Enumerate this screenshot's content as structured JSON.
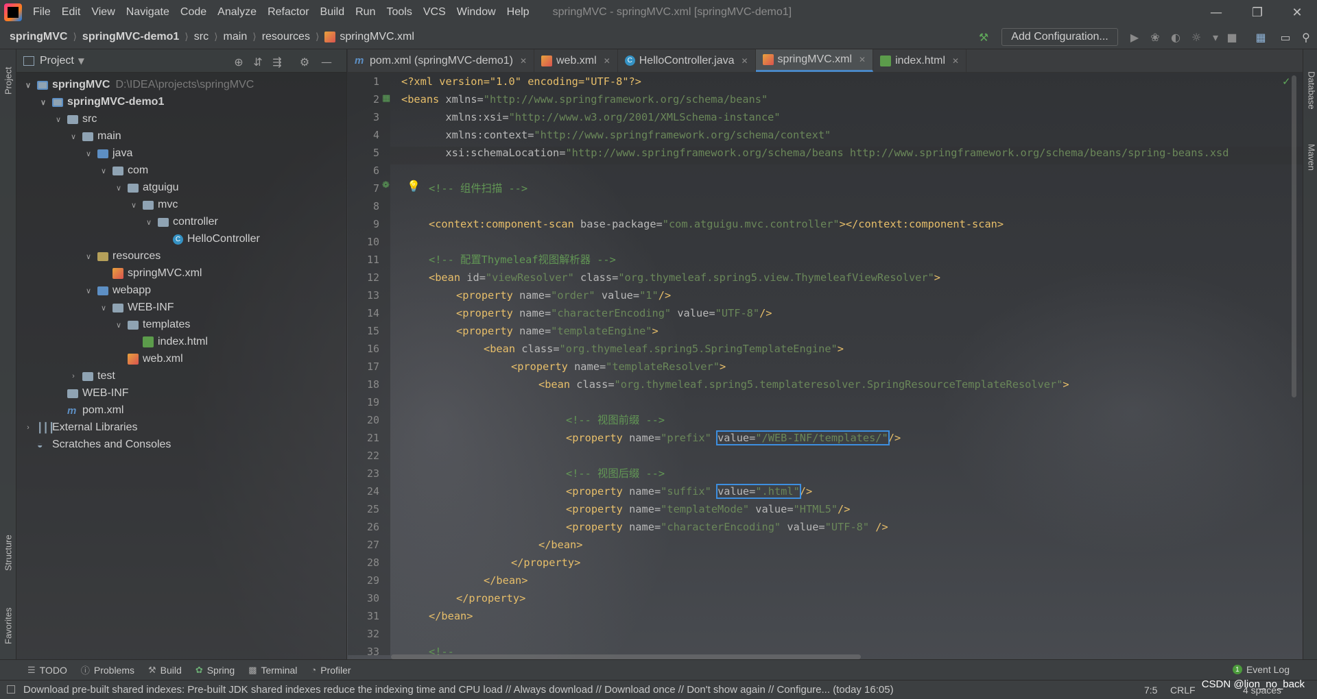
{
  "window": {
    "title": "springMVC - springMVC.xml [springMVC-demo1]",
    "menu": [
      "File",
      "Edit",
      "View",
      "Navigate",
      "Code",
      "Analyze",
      "Refactor",
      "Build",
      "Run",
      "Tools",
      "VCS",
      "Window",
      "Help"
    ]
  },
  "navbar": {
    "breadcrumbs": [
      "springMVC",
      "springMVC-demo1",
      "src",
      "main",
      "resources",
      "springMVC.xml"
    ],
    "add_config": "Add Configuration..."
  },
  "left_strip": {
    "project": "Project",
    "structure": "Structure",
    "favorites": "Favorites"
  },
  "right_strip": {
    "database": "Database",
    "maven": "Maven"
  },
  "project_panel": {
    "title": "Project",
    "root_path": "D:\\IDEA\\projects\\springMVC",
    "tree": [
      {
        "label": "springMVC",
        "depth": 0,
        "kind": "module",
        "expanded": true
      },
      {
        "label": "springMVC-demo1",
        "depth": 1,
        "kind": "module",
        "expanded": true
      },
      {
        "label": "src",
        "depth": 2,
        "kind": "folder",
        "expanded": true
      },
      {
        "label": "main",
        "depth": 3,
        "kind": "folder",
        "expanded": true
      },
      {
        "label": "java",
        "depth": 4,
        "kind": "src",
        "expanded": true
      },
      {
        "label": "com",
        "depth": 5,
        "kind": "folder",
        "expanded": true
      },
      {
        "label": "atguigu",
        "depth": 6,
        "kind": "folder",
        "expanded": true
      },
      {
        "label": "mvc",
        "depth": 7,
        "kind": "folder",
        "expanded": true
      },
      {
        "label": "controller",
        "depth": 8,
        "kind": "folder",
        "expanded": true
      },
      {
        "label": "HelloController",
        "depth": 9,
        "kind": "class"
      },
      {
        "label": "resources",
        "depth": 4,
        "kind": "res",
        "expanded": true
      },
      {
        "label": "springMVC.xml",
        "depth": 5,
        "kind": "xml"
      },
      {
        "label": "webapp",
        "depth": 4,
        "kind": "src",
        "expanded": true
      },
      {
        "label": "WEB-INF",
        "depth": 5,
        "kind": "folder",
        "expanded": true
      },
      {
        "label": "templates",
        "depth": 6,
        "kind": "folder",
        "expanded": true
      },
      {
        "label": "index.html",
        "depth": 7,
        "kind": "html"
      },
      {
        "label": "web.xml",
        "depth": 6,
        "kind": "xml"
      },
      {
        "label": "test",
        "depth": 3,
        "kind": "folder",
        "expanded": false
      },
      {
        "label": "WEB-INF",
        "depth": 2,
        "kind": "folder"
      },
      {
        "label": "pom.xml",
        "depth": 2,
        "kind": "maven"
      },
      {
        "label": "External Libraries",
        "depth": 0,
        "kind": "lib",
        "expanded": false
      },
      {
        "label": "Scratches and Consoles",
        "depth": 0,
        "kind": "scratch"
      }
    ]
  },
  "tabs": [
    {
      "label": "pom.xml (springMVC-demo1)",
      "icon": "m",
      "active": false
    },
    {
      "label": "web.xml",
      "icon": "xml",
      "active": false
    },
    {
      "label": "HelloController.java",
      "icon": "class",
      "active": false
    },
    {
      "label": "springMVC.xml",
      "icon": "xml",
      "active": true
    },
    {
      "label": "index.html",
      "icon": "html",
      "active": false
    }
  ],
  "code_lines": [
    "1",
    "2",
    "3",
    "4",
    "5",
    "6",
    "7",
    "8",
    "9",
    "10",
    "11",
    "12",
    "13",
    "14",
    "15",
    "16",
    "17",
    "18",
    "19",
    "20",
    "21",
    "22",
    "23",
    "24",
    "25",
    "26",
    "27",
    "28",
    "29",
    "30",
    "31",
    "32",
    "33"
  ],
  "code": {
    "l1": "<?xml version=\"1.0\" encoding=\"UTF-8\"?>",
    "l2a": "<beans",
    "l2b": " xmlns=",
    "l2c": "\"http://www.springframework.org/schema/beans\"",
    "l3a": "       xmlns:xsi=",
    "l3b": "\"http://www.w3.org/2001/XMLSchema-instance\"",
    "l4a": "       xmlns:context=",
    "l4b": "\"http://www.springframework.org/schema/context\"",
    "l5a": "       xsi:schemaLocation=",
    "l5b": "\"http://www.springframework.org/schema/beans http://www.springframework.org/schema/beans/spring-beans.xsd",
    "l7": "<!-- 组件扫描 -->",
    "l9a": "<context:component-scan",
    "l9b": " base-package=",
    "l9c": "\"com.atguigu.mvc.controller\"",
    "l9d": "></context:component-scan>",
    "l11": "<!-- 配置Thymeleaf视图解析器 -->",
    "l12a": "<bean",
    "l12b": " id=",
    "l12c": "\"viewResolver\"",
    "l12d": " class=",
    "l12e": "\"org.thymeleaf.spring5.view.ThymeleafViewResolver\"",
    "l12f": ">",
    "l13a": "<property",
    "l13b": " name=",
    "l13c": "\"order\"",
    "l13d": " value=",
    "l13e": "\"1\"",
    "l13f": "/>",
    "l14c": "\"characterEncoding\"",
    "l14e": "\"UTF-8\"",
    "l15c": "\"templateEngine\"",
    "l15f": ">",
    "l16c": "\"org.thymeleaf.spring5.SpringTemplateEngine\"",
    "l17c": "\"templateResolver\"",
    "l18c": "\"org.thymeleaf.spring5.templateresolver.SpringResourceTemplateResolver\"",
    "l20": "<!-- 视图前缀 -->",
    "l21c": "\"prefix\"",
    "l21e": "\"/WEB-INF/templates/\"",
    "l23": "<!-- 视图后缀 -->",
    "l24c": "\"suffix\"",
    "l24e": "\".html\"",
    "l25c": "\"templateMode\"",
    "l25e": "\"HTML5\"",
    "l26c": "\"characterEncoding\"",
    "l26e": "\"UTF-8\"",
    "l26f": " />",
    "l27": "</bean>",
    "l28": "</property>",
    "l29": "</bean>",
    "l30": "</property>",
    "l31": "</bean>",
    "l33": "<!--"
  },
  "bottom_tools": [
    "TODO",
    "Problems",
    "Build",
    "Spring",
    "Terminal",
    "Profiler"
  ],
  "event_log": {
    "label": "Event Log",
    "count": "1"
  },
  "status": {
    "message": "Download pre-built shared indexes: Pre-built JDK shared indexes reduce the indexing time and CPU load // Always download // Download once // Don't show again // Configure... (today 16:05)",
    "position": "7:5",
    "line_sep": "CRLF",
    "indent": "4 spaces",
    "watermark": "CSDN @lion_no_back"
  }
}
